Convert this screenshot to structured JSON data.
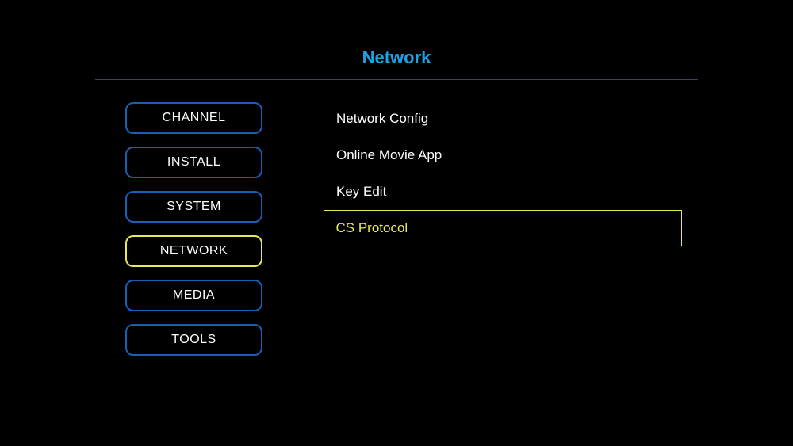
{
  "title": "Network",
  "sidebar": {
    "items": [
      {
        "label": "CHANNEL",
        "name": "sidebar-item-channel",
        "active": false
      },
      {
        "label": "INSTALL",
        "name": "sidebar-item-install",
        "active": false
      },
      {
        "label": "SYSTEM",
        "name": "sidebar-item-system",
        "active": false
      },
      {
        "label": "NETWORK",
        "name": "sidebar-item-network",
        "active": true
      },
      {
        "label": "MEDIA",
        "name": "sidebar-item-media",
        "active": false
      },
      {
        "label": "TOOLS",
        "name": "sidebar-item-tools",
        "active": false
      }
    ]
  },
  "main": {
    "items": [
      {
        "label": "Network Config",
        "name": "menu-item-network-config",
        "selected": false
      },
      {
        "label": "Online Movie App",
        "name": "menu-item-online-movie-app",
        "selected": false
      },
      {
        "label": "Key Edit",
        "name": "menu-item-key-edit",
        "selected": false
      },
      {
        "label": "CS Protocol",
        "name": "menu-item-cs-protocol",
        "selected": true
      }
    ]
  }
}
